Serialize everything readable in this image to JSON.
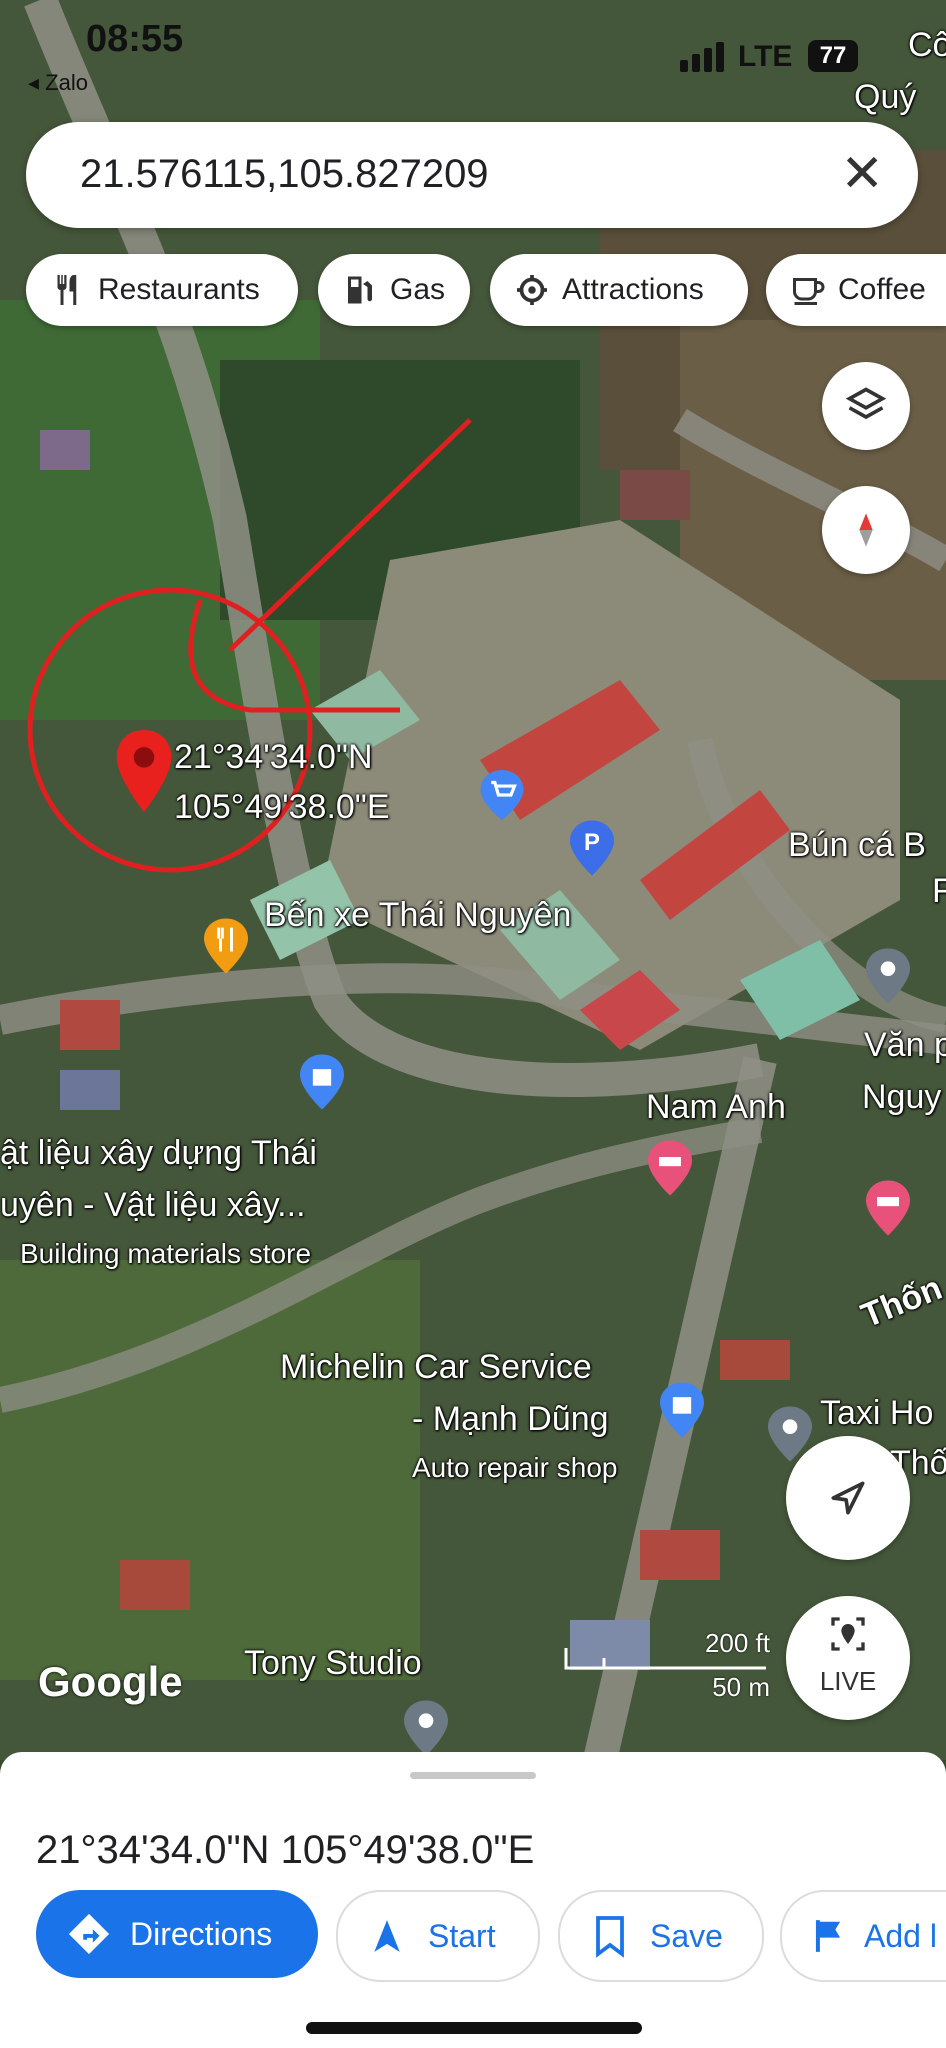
{
  "status": {
    "time": "08:55",
    "back_app": "◂ Zalo",
    "network": "LTE",
    "battery": "77"
  },
  "search": {
    "query": "21.576115,105.827209"
  },
  "chips": [
    {
      "label": "Restaurants",
      "icon": "fork-knife-icon"
    },
    {
      "label": "Gas",
      "icon": "gas-pump-icon"
    },
    {
      "label": "Attractions",
      "icon": "attractions-icon"
    },
    {
      "label": "Coffee",
      "icon": "coffee-cup-icon"
    }
  ],
  "map": {
    "pin_lat": "21°34'34.0\"N",
    "pin_lng": "105°49'38.0\"E",
    "places": {
      "ben_xe": "Bến xe Thái Nguyên",
      "bun_ca": "Bún cá B",
      "bun_ca_line2": "F",
      "van": "Văn p",
      "van_line2": "Nguy",
      "nam_anh": "Nam Anh",
      "vlxd_line1": "ật liệu xây dựng Thái",
      "vlxd_line2": "uyên - Vật liệu xây...",
      "vlxd_type": "Building materials store",
      "michelin_line1": "Michelin Car Service",
      "michelin_line2": "- Mạnh Dũng",
      "michelin_type": "Auto repair shop",
      "taxi": "Taxi Ho",
      "taxi_line2": "Thố",
      "thong": "Thốn",
      "tony": "Tony Studio",
      "corner_top": "Cô",
      "corner_top2": "Quý "
    },
    "attribution": "Google",
    "scale_ft": "200 ft",
    "scale_m": "50 m",
    "live_label": "LIVE"
  },
  "sheet": {
    "coordinates": "21°34'34.0\"N 105°49'38.0\"E",
    "actions": {
      "directions": "Directions",
      "start": "Start",
      "save": "Save",
      "add": "Add l"
    }
  }
}
